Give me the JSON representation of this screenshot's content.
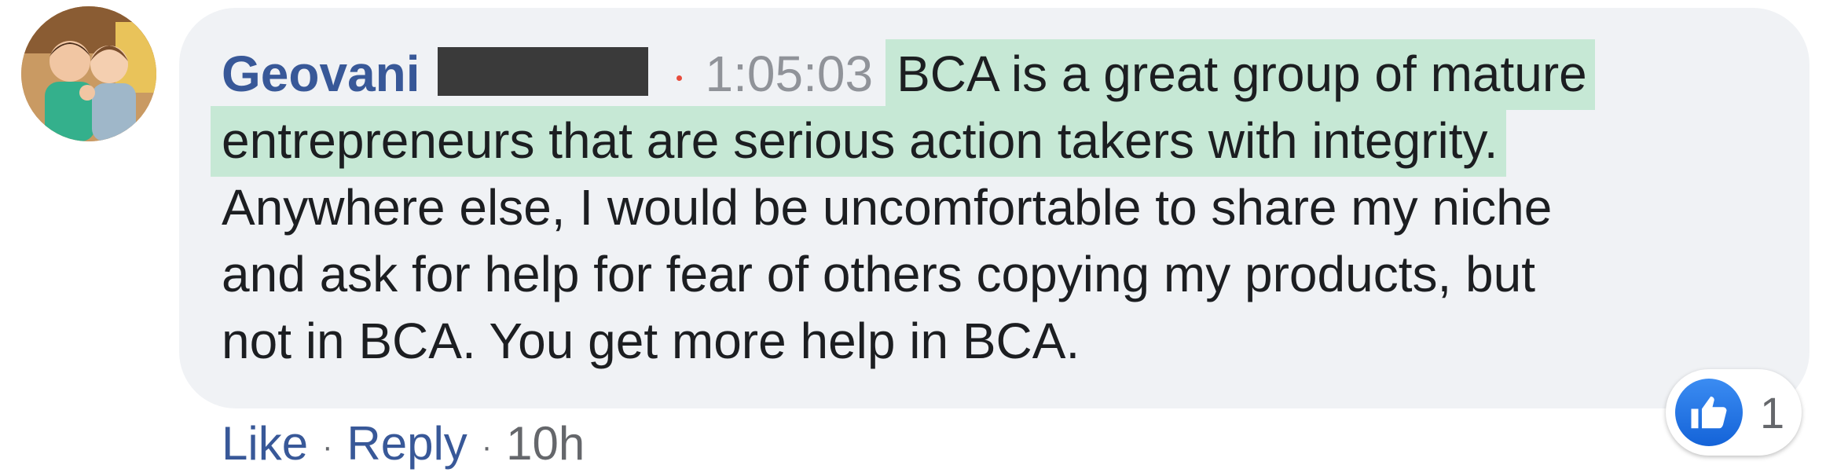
{
  "comment": {
    "author": "Geovani",
    "timestamp": "1:05:03",
    "highlighted_line1": "BCA is a great group of mature",
    "highlighted_line2": "entrepreneurs that are serious action takers with integrity.",
    "line3": "Anywhere else, I would be uncomfortable to share my niche",
    "line4": "and ask for help for fear of others copying my products, but",
    "line5": "not in BCA. You get more help in BCA."
  },
  "actions": {
    "like_label": "Like",
    "reply_label": "Reply",
    "age": "10h"
  },
  "reactions": {
    "icon": "thumbs-up-icon",
    "count": "1"
  },
  "colors": {
    "author": "#385898",
    "highlight": "#c6e8d5",
    "bubble": "#f0f2f5",
    "like_blue": "#1877f2"
  }
}
